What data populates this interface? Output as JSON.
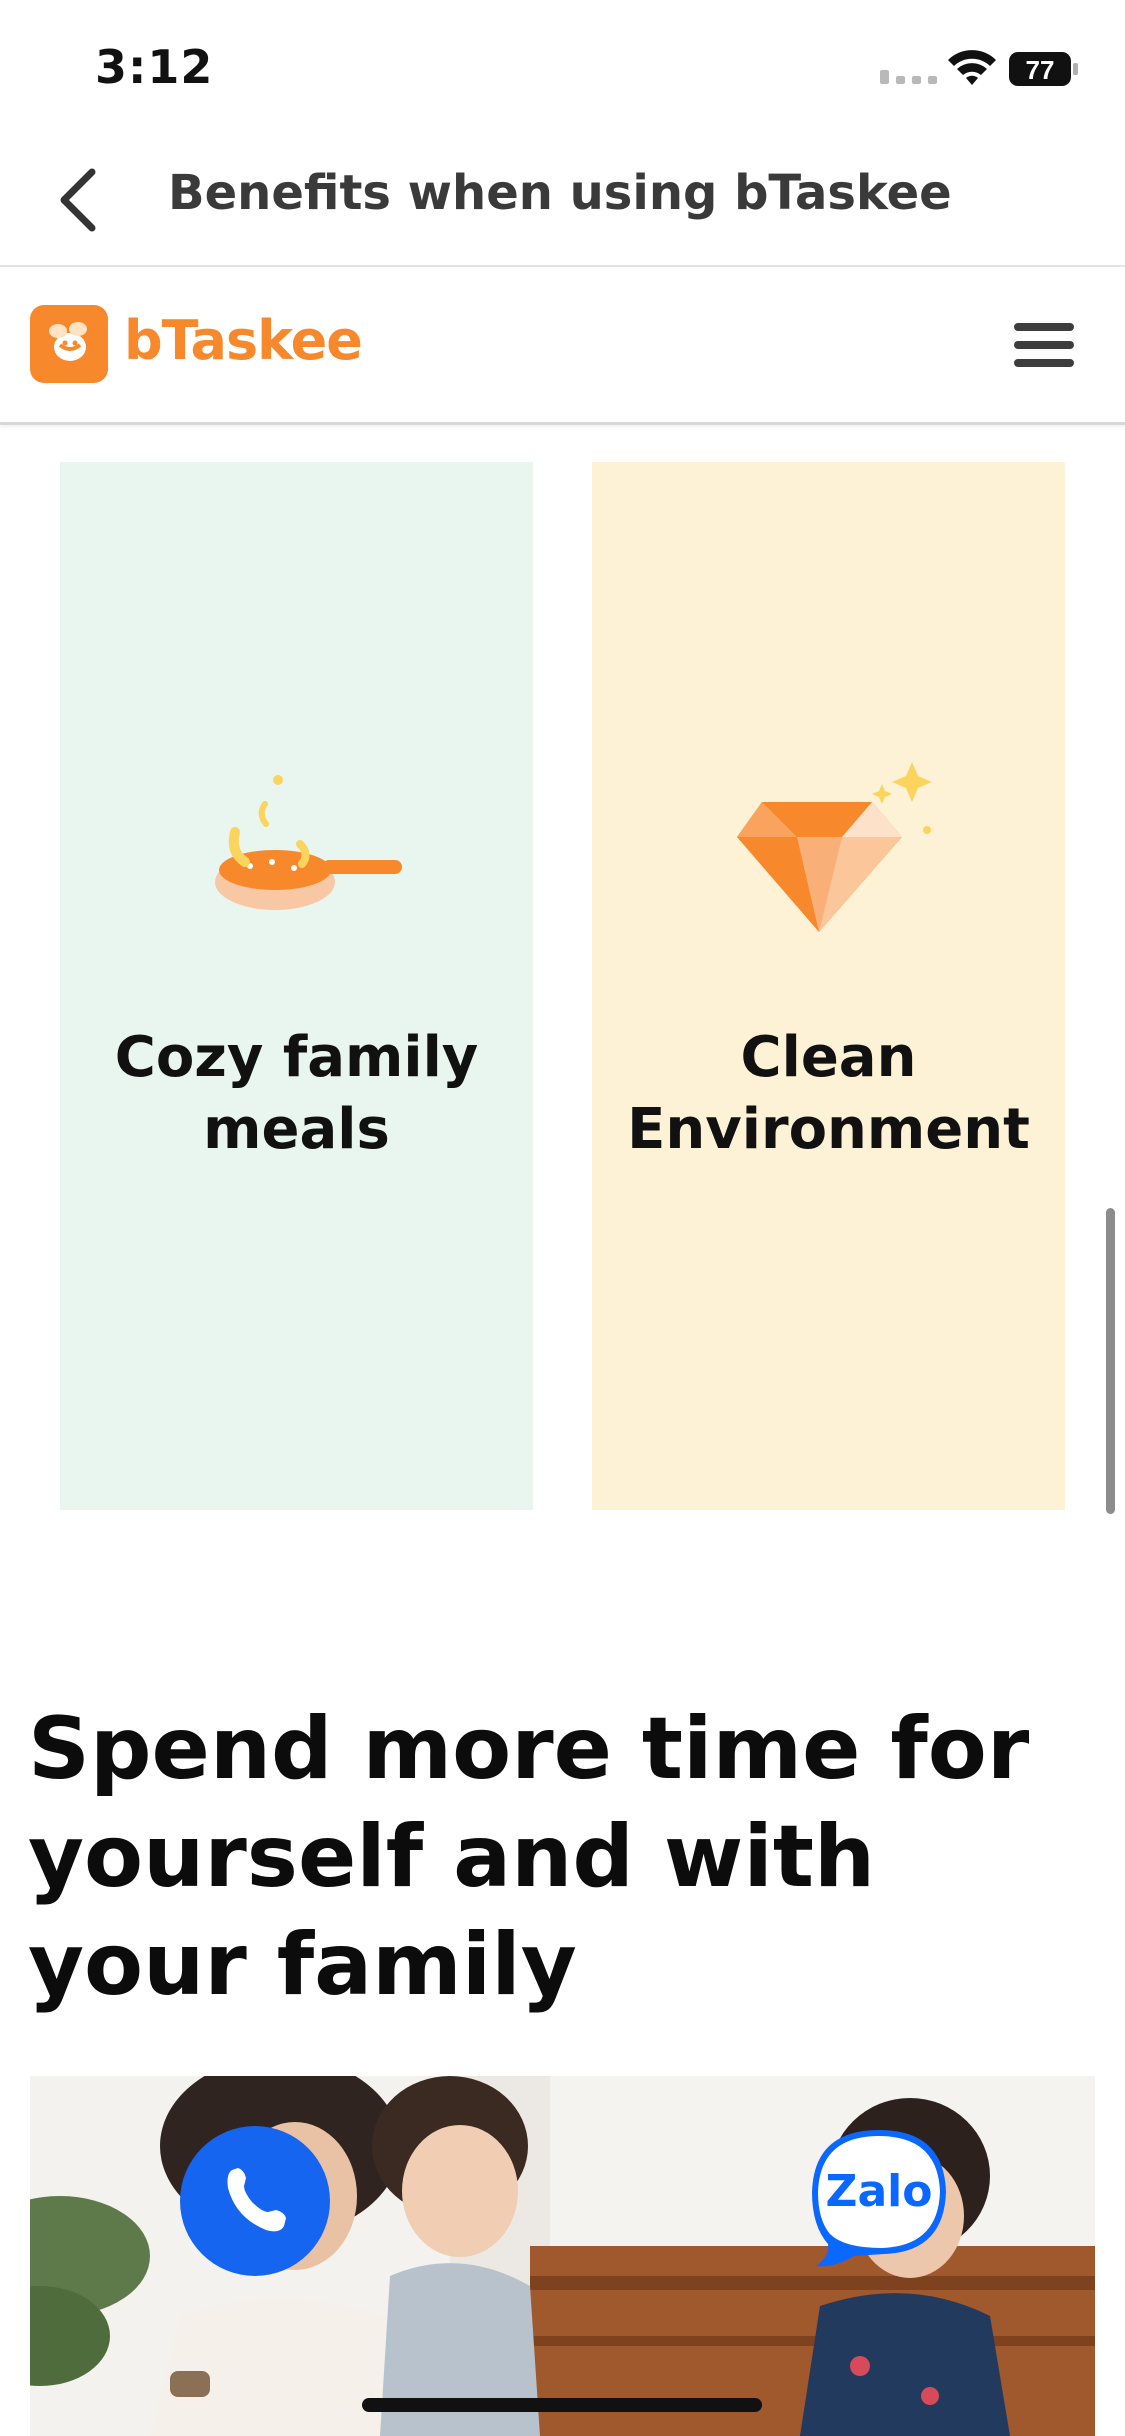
{
  "status_bar": {
    "time": "3:12",
    "battery": "77"
  },
  "nav": {
    "title": "Benefits when using bTaskee",
    "back_icon": "chevron-left-icon"
  },
  "site_header": {
    "logo_text": "bTaskee",
    "logo_icon": "bee-icon",
    "menu_icon": "hamburger-menu-icon",
    "brand_color": "#f7882b"
  },
  "cards": [
    {
      "title": "Cozy family meals",
      "icon": "frying-pan-icon",
      "background": "#e9f5ef"
    },
    {
      "title": "Clean Environment",
      "icon": "diamond-icon",
      "background": "#fdf1d6"
    }
  ],
  "section": {
    "heading": "Spend more time for yourself and with your family"
  },
  "floating_actions": {
    "call_icon": "phone-icon",
    "zalo_label": "Zalo"
  }
}
